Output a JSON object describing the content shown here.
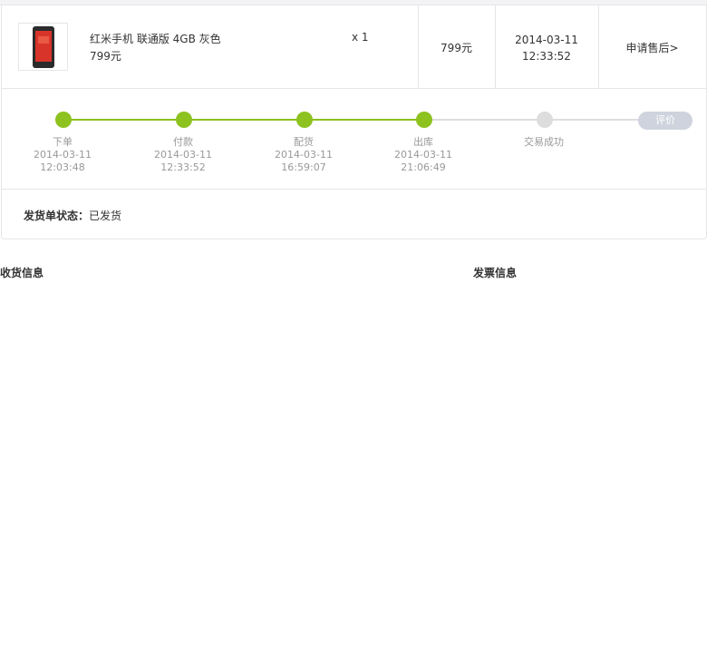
{
  "product": {
    "name": "红米手机 联通版 4GB 灰色",
    "unit_price": "799元",
    "quantity": "x 1",
    "price": "799元",
    "date": "2014-03-11",
    "time": "12:33:52",
    "after_sale": "申请售后>"
  },
  "progress": {
    "steps": [
      {
        "label": "下单",
        "date": "2014-03-11",
        "time": "12:03:48",
        "done": true
      },
      {
        "label": "付款",
        "date": "2014-03-11",
        "time": "12:33:52",
        "done": true
      },
      {
        "label": "配货",
        "date": "2014-03-11",
        "time": "16:59:07",
        "done": true
      },
      {
        "label": "出库",
        "date": "2014-03-11",
        "time": "21:06:49",
        "done": true
      },
      {
        "label": "交易成功",
        "date": "",
        "time": "",
        "done": false
      }
    ],
    "review_button": "评价",
    "colors": {
      "done": "#8dc21f",
      "pending": "#dddddd"
    }
  },
  "shipment": {
    "status_label": "发货单状态：",
    "status_value": "已发货"
  },
  "sections": {
    "shipping_info": "收货信息",
    "invoice_info": "发票信息"
  }
}
